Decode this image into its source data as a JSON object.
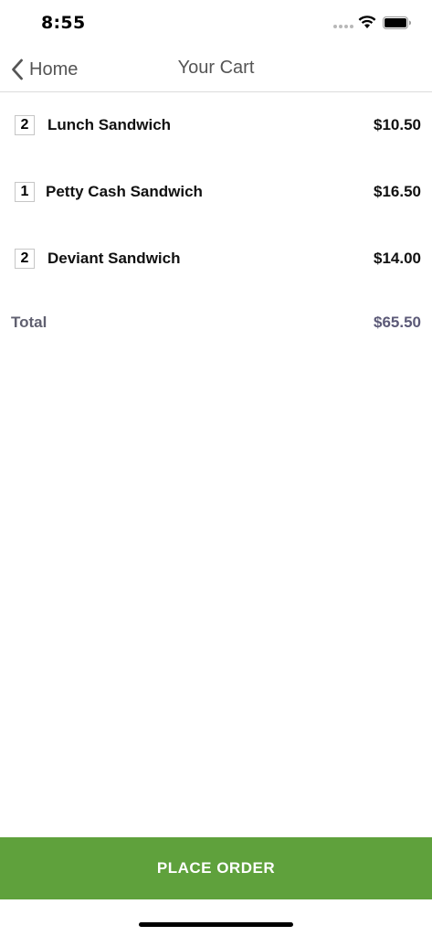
{
  "status_bar": {
    "time": "8:55"
  },
  "nav": {
    "back_label": "Home",
    "title": "Your Cart"
  },
  "cart": {
    "items": [
      {
        "qty": "2",
        "name": "Lunch Sandwich",
        "price": "$10.50"
      },
      {
        "qty": "1",
        "name": "Petty Cash Sandwich",
        "price": "$16.50"
      },
      {
        "qty": "2",
        "name": "Deviant Sandwich",
        "price": "$14.00"
      }
    ],
    "total_label": "Total",
    "total_value": "$65.50"
  },
  "actions": {
    "place_order_label": "PLACE ORDER"
  },
  "colors": {
    "accent": "#5fa13c",
    "total_value": "#5c5a78"
  }
}
